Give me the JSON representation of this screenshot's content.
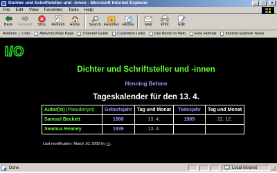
{
  "window": {
    "title": "Dichter und Schriftsteller und -innen - Microsoft Internet Explorer",
    "minimize": "_",
    "maximize": "□",
    "close": "×"
  },
  "menu": [
    "File",
    "Edit",
    "View",
    "Favorites",
    "Tools",
    "Help"
  ],
  "toolbar": {
    "back": "Back",
    "forward": "Forward",
    "stop": "Stop",
    "refresh": "Refresh",
    "home": "Home",
    "search": "Search",
    "favorites": "Favorites",
    "history": "History",
    "mail": "Mail",
    "print": "Print",
    "edit": "Edit"
  },
  "addressbar": {
    "address_label": "Address",
    "links_label": "Links",
    "links": [
      "AltaVista Main Page",
      "Channel Guide",
      "Customize Links",
      "Das Beste im Web",
      "Free Hotmail",
      "Internet Explorer News"
    ]
  },
  "page": {
    "logo": "I/O",
    "title": "Dichter und Schriftsteller und -innen",
    "author": "Henning Behme",
    "subtitle": "Tageskalender für den 13. 4.",
    "table": {
      "headers": {
        "author": "Autor(in)",
        "pseudonym": "[Pseudonym]",
        "birth_year": "Geburtsjahr",
        "day_month": "Tag und Monat",
        "death_year": "Todesjahr",
        "day_month2": "Tag und Monat"
      },
      "rows": [
        {
          "author": "Samuel Beckett",
          "birth_year": "1906",
          "birth_day": "13. 4.",
          "death_year": "1969",
          "death_day": "22. 12."
        },
        {
          "author": "Seamus Heaney",
          "birth_year": "1939",
          "birth_day": "13. 4.",
          "death_year": "",
          "death_day": ""
        }
      ]
    },
    "last_modified_prefix": "Last modification: March 10, 2000 by",
    "last_modified_by": "hb",
    "last_modified_suffix": "."
  },
  "status": {
    "text": "Done",
    "zone": "Local intranet"
  },
  "colors": {
    "content_bg": "#000000",
    "green": "#66ff33",
    "lilac": "#9999ff"
  }
}
